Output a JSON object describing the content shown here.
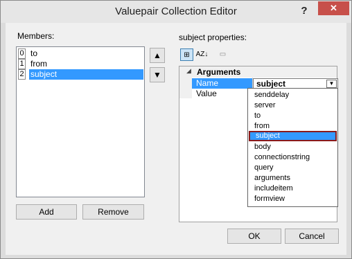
{
  "window": {
    "title": "Valuepair Collection Editor",
    "help_label": "?",
    "close_label": "✕"
  },
  "members": {
    "label": "Members:",
    "items": [
      {
        "index": "0",
        "name": "to"
      },
      {
        "index": "1",
        "name": "from"
      },
      {
        "index": "2",
        "name": "subject",
        "selected": true
      }
    ],
    "move_up_icon": "▲",
    "move_down_icon": "▼",
    "add_label": "Add",
    "remove_label": "Remove"
  },
  "properties": {
    "label": "subject properties:",
    "toolbar": {
      "categorized_icon": "⊞",
      "alphabetical_icon": "AZ↓",
      "pages_icon": "▭"
    },
    "category": {
      "toggle": "◢",
      "label": "Arguments"
    },
    "rows": [
      {
        "name": "Name",
        "value": "subject",
        "selected": true
      },
      {
        "name": "Value",
        "value": ""
      }
    ],
    "dropdown_arrow": "▼",
    "dropdown_options": [
      "senddelay",
      "server",
      "to",
      "from",
      "subject",
      "body",
      "connectionstring",
      "query",
      "arguments",
      "includeitem",
      "formview"
    ],
    "dropdown_selected": "subject"
  },
  "footer": {
    "ok_label": "OK",
    "cancel_label": "Cancel"
  }
}
